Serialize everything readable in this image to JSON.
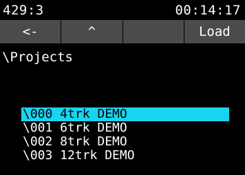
{
  "status": {
    "left_text": "429:3",
    "right_text": "00:14:17"
  },
  "toolbar": {
    "buttons": [
      {
        "label": "<-"
      },
      {
        "label": "^"
      },
      {
        "label": ""
      },
      {
        "label": "Load"
      }
    ]
  },
  "browser": {
    "path": "\\Projects",
    "items": [
      {
        "label": "\\000 4trk DEMO",
        "selected": true
      },
      {
        "label": "\\001 6trk DEMO",
        "selected": false
      },
      {
        "label": "\\002 8trk DEMO",
        "selected": false
      },
      {
        "label": "\\003 12trk DEMO",
        "selected": false
      }
    ]
  },
  "colors": {
    "background": "#000000",
    "toolbar": "#4b4b4b",
    "selection": "#19d4f0",
    "text": "#ffffff",
    "selected_text": "#000000"
  }
}
